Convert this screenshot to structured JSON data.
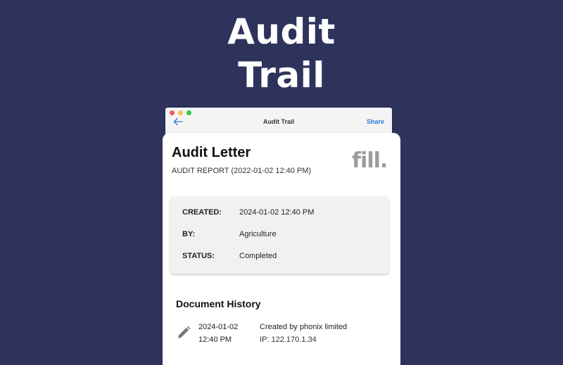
{
  "hero": {
    "line1": "Audit",
    "line2": "Trail"
  },
  "window": {
    "title": "Audit Trail",
    "share_label": "Share",
    "back_icon": "arrow-left-icon"
  },
  "document": {
    "title": "Audit Letter",
    "subtitle": "AUDIT REPORT (2022-01-02  12:40 PM)",
    "logo_text": "fill."
  },
  "info": {
    "created_label": "CREATED:",
    "created_value": "2024-01-02 12:40 PM",
    "by_label": "BY:",
    "by_value": "Agriculture",
    "status_label": "STATUS:",
    "status_value": "Completed"
  },
  "history": {
    "title": "Document History",
    "entries": [
      {
        "icon": "pencil-icon",
        "date": "2024-01-02",
        "time": "12:40 PM",
        "description": "Created by phonix limited",
        "ip": "IP: 122.170.1.34"
      }
    ]
  },
  "colors": {
    "background": "#2d335b",
    "accent": "#2a7bd6",
    "logo": "#9c9c9c"
  }
}
